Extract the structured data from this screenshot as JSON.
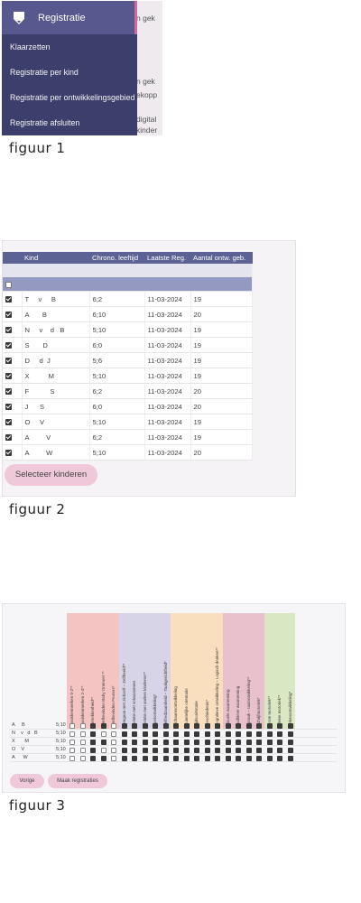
{
  "figure1": {
    "caption": "figuur 1",
    "menu_title": "Registratie",
    "menu_items": [
      "Klaarzetten",
      "Registratie per kind",
      "Registratie per ontwikkelingsgebied",
      "Registratie afsluiten"
    ],
    "background_fragments": [
      "n gek",
      "n gek",
      "ekopp",
      "digital",
      "kinder"
    ],
    "colors": {
      "menu_bg": "#3c3f6b",
      "menu_head_bg": "#56588e",
      "accent": "#d0689a"
    },
    "icons": [
      "pencil-icon"
    ]
  },
  "figure2": {
    "caption": "figuur 2",
    "columns": [
      "Kind",
      "Chrono. leeftijd",
      "Laatste Reg.",
      "Aantal ontw. geb."
    ],
    "rows": [
      {
        "kind": "T     v     B",
        "leeftijd": "6;2",
        "datum": "11-03-2024",
        "aantal": "19",
        "checked": true
      },
      {
        "kind": "A       B",
        "leeftijd": "6;10",
        "datum": "11-03-2024",
        "aantal": "20",
        "checked": true
      },
      {
        "kind": "N     v    d   B",
        "leeftijd": "5;10",
        "datum": "11-03-2024",
        "aantal": "19",
        "checked": true
      },
      {
        "kind": "S       D",
        "leeftijd": "6;0",
        "datum": "11-03-2024",
        "aantal": "19",
        "checked": true
      },
      {
        "kind": "D     d  J",
        "leeftijd": "5;6",
        "datum": "11-03-2024",
        "aantal": "19",
        "checked": true
      },
      {
        "kind": "X          M",
        "leeftijd": "5;10",
        "datum": "11-03-2024",
        "aantal": "19",
        "checked": true
      },
      {
        "kind": "F           S",
        "leeftijd": "6;2",
        "datum": "11-03-2024",
        "aantal": "20",
        "checked": true
      },
      {
        "kind": "J      S",
        "leeftijd": "6;0",
        "datum": "11-03-2024",
        "aantal": "20",
        "checked": true
      },
      {
        "kind": "O     V",
        "leeftijd": "5;10",
        "datum": "11-03-2024",
        "aantal": "19",
        "checked": true
      },
      {
        "kind": "A         V",
        "leeftijd": "6;2",
        "datum": "11-03-2024",
        "aantal": "19",
        "checked": true
      },
      {
        "kind": "A         W",
        "leeftijd": "5;10",
        "datum": "11-03-2024",
        "aantal": "20",
        "checked": true
      }
    ],
    "select_all_checked": false,
    "button_label": "Selecteer kinderen"
  },
  "figure3": {
    "caption": "figuur 3",
    "groups": [
      {
        "color": "#f3c4c1",
        "columns": [
          "Basiskenmerken 0-2**",
          "Basiskenmerken 2-4**",
          "Betrokkenheid**",
          "Welbevinden Baby Ontmoet **",
          "Welbevinden Peuters*"
        ]
      },
      {
        "color": "#d6d4e6",
        "columns": [
          "Omgaan met zichzelf – Zelfbeeld**",
          "Relatie met volwassenen",
          "Relatie met andere kinderen**",
          "Spelontwikkeling*",
          "Zelfredzaamheid – Taakgerichtheid*"
        ]
      },
      {
        "color": "#f9dfbd",
        "columns": [
          "Lichaamsontwikkeling",
          "Ruimtelijke oriëntatie",
          "Tijdsoriëntatie",
          "Geschiedenis*",
          "Cognitieve ontwikkeling – Logisch denken**"
        ]
      },
      {
        "color": "#e8c1cc",
        "columns": [
          "Visuele waarneming",
          "Auditieve waarneming",
          "Spraak – taalontwikkeling**",
          "Schrijfmotoriek*"
        ]
      },
      {
        "color": "#d9e8c3",
        "columns": [
          "Grote motoriek**",
          "Kleine motoriek**",
          "Tekenontwikkeling*"
        ]
      }
    ],
    "rows": [
      {
        "name": "A     B",
        "age": "5;10",
        "cells": [
          0,
          0,
          1,
          1,
          0,
          1,
          1,
          1,
          1,
          1,
          1,
          1,
          1,
          1,
          1,
          1,
          1,
          1,
          1,
          1,
          1,
          1
        ]
      },
      {
        "name": "N    v   d   B",
        "age": "5;10",
        "cells": [
          0,
          0,
          1,
          0,
          0,
          1,
          1,
          1,
          1,
          1,
          1,
          1,
          1,
          1,
          1,
          1,
          1,
          1,
          1,
          1,
          1,
          1
        ]
      },
      {
        "name": "X       M",
        "age": "5;10",
        "cells": [
          0,
          0,
          1,
          1,
          0,
          1,
          1,
          1,
          1,
          1,
          1,
          1,
          1,
          1,
          1,
          1,
          1,
          1,
          1,
          1,
          1,
          1
        ]
      },
      {
        "name": "O    V",
        "age": "5;10",
        "cells": [
          0,
          0,
          1,
          0,
          0,
          1,
          1,
          1,
          1,
          1,
          1,
          1,
          1,
          1,
          1,
          1,
          1,
          1,
          1,
          1,
          1,
          1
        ]
      },
      {
        "name": "A      W",
        "age": "5;10",
        "cells": [
          0,
          0,
          1,
          1,
          0,
          1,
          1,
          1,
          1,
          1,
          1,
          1,
          1,
          1,
          1,
          1,
          1,
          1,
          1,
          1,
          1,
          1
        ]
      }
    ],
    "prev_button": "Vorige",
    "make_button": "Maak registraties"
  }
}
